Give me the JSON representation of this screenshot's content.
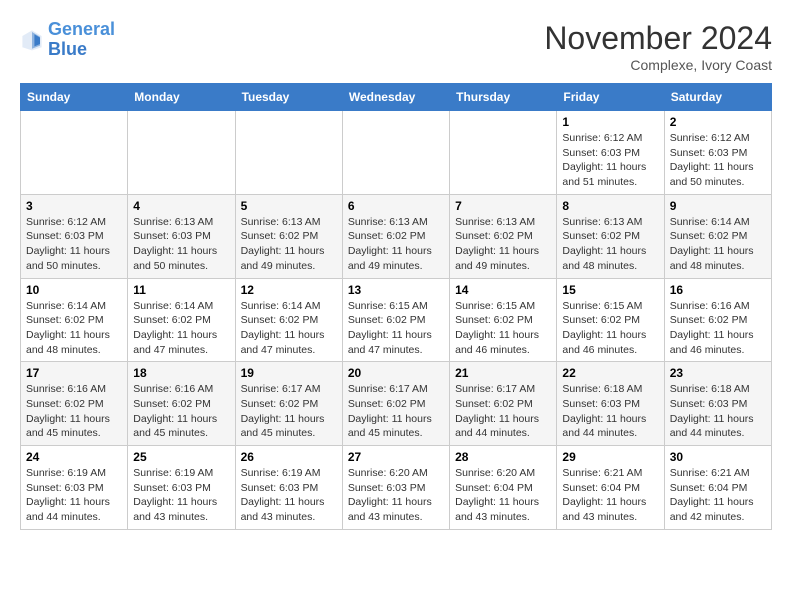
{
  "header": {
    "logo_line1": "General",
    "logo_line2": "Blue",
    "month": "November 2024",
    "location": "Complexe, Ivory Coast"
  },
  "weekdays": [
    "Sunday",
    "Monday",
    "Tuesday",
    "Wednesday",
    "Thursday",
    "Friday",
    "Saturday"
  ],
  "weeks": [
    [
      {
        "day": "",
        "info": ""
      },
      {
        "day": "",
        "info": ""
      },
      {
        "day": "",
        "info": ""
      },
      {
        "day": "",
        "info": ""
      },
      {
        "day": "",
        "info": ""
      },
      {
        "day": "1",
        "info": "Sunrise: 6:12 AM\nSunset: 6:03 PM\nDaylight: 11 hours\nand 51 minutes."
      },
      {
        "day": "2",
        "info": "Sunrise: 6:12 AM\nSunset: 6:03 PM\nDaylight: 11 hours\nand 50 minutes."
      }
    ],
    [
      {
        "day": "3",
        "info": "Sunrise: 6:12 AM\nSunset: 6:03 PM\nDaylight: 11 hours\nand 50 minutes."
      },
      {
        "day": "4",
        "info": "Sunrise: 6:13 AM\nSunset: 6:03 PM\nDaylight: 11 hours\nand 50 minutes."
      },
      {
        "day": "5",
        "info": "Sunrise: 6:13 AM\nSunset: 6:02 PM\nDaylight: 11 hours\nand 49 minutes."
      },
      {
        "day": "6",
        "info": "Sunrise: 6:13 AM\nSunset: 6:02 PM\nDaylight: 11 hours\nand 49 minutes."
      },
      {
        "day": "7",
        "info": "Sunrise: 6:13 AM\nSunset: 6:02 PM\nDaylight: 11 hours\nand 49 minutes."
      },
      {
        "day": "8",
        "info": "Sunrise: 6:13 AM\nSunset: 6:02 PM\nDaylight: 11 hours\nand 48 minutes."
      },
      {
        "day": "9",
        "info": "Sunrise: 6:14 AM\nSunset: 6:02 PM\nDaylight: 11 hours\nand 48 minutes."
      }
    ],
    [
      {
        "day": "10",
        "info": "Sunrise: 6:14 AM\nSunset: 6:02 PM\nDaylight: 11 hours\nand 48 minutes."
      },
      {
        "day": "11",
        "info": "Sunrise: 6:14 AM\nSunset: 6:02 PM\nDaylight: 11 hours\nand 47 minutes."
      },
      {
        "day": "12",
        "info": "Sunrise: 6:14 AM\nSunset: 6:02 PM\nDaylight: 11 hours\nand 47 minutes."
      },
      {
        "day": "13",
        "info": "Sunrise: 6:15 AM\nSunset: 6:02 PM\nDaylight: 11 hours\nand 47 minutes."
      },
      {
        "day": "14",
        "info": "Sunrise: 6:15 AM\nSunset: 6:02 PM\nDaylight: 11 hours\nand 46 minutes."
      },
      {
        "day": "15",
        "info": "Sunrise: 6:15 AM\nSunset: 6:02 PM\nDaylight: 11 hours\nand 46 minutes."
      },
      {
        "day": "16",
        "info": "Sunrise: 6:16 AM\nSunset: 6:02 PM\nDaylight: 11 hours\nand 46 minutes."
      }
    ],
    [
      {
        "day": "17",
        "info": "Sunrise: 6:16 AM\nSunset: 6:02 PM\nDaylight: 11 hours\nand 45 minutes."
      },
      {
        "day": "18",
        "info": "Sunrise: 6:16 AM\nSunset: 6:02 PM\nDaylight: 11 hours\nand 45 minutes."
      },
      {
        "day": "19",
        "info": "Sunrise: 6:17 AM\nSunset: 6:02 PM\nDaylight: 11 hours\nand 45 minutes."
      },
      {
        "day": "20",
        "info": "Sunrise: 6:17 AM\nSunset: 6:02 PM\nDaylight: 11 hours\nand 45 minutes."
      },
      {
        "day": "21",
        "info": "Sunrise: 6:17 AM\nSunset: 6:02 PM\nDaylight: 11 hours\nand 44 minutes."
      },
      {
        "day": "22",
        "info": "Sunrise: 6:18 AM\nSunset: 6:03 PM\nDaylight: 11 hours\nand 44 minutes."
      },
      {
        "day": "23",
        "info": "Sunrise: 6:18 AM\nSunset: 6:03 PM\nDaylight: 11 hours\nand 44 minutes."
      }
    ],
    [
      {
        "day": "24",
        "info": "Sunrise: 6:19 AM\nSunset: 6:03 PM\nDaylight: 11 hours\nand 44 minutes."
      },
      {
        "day": "25",
        "info": "Sunrise: 6:19 AM\nSunset: 6:03 PM\nDaylight: 11 hours\nand 43 minutes."
      },
      {
        "day": "26",
        "info": "Sunrise: 6:19 AM\nSunset: 6:03 PM\nDaylight: 11 hours\nand 43 minutes."
      },
      {
        "day": "27",
        "info": "Sunrise: 6:20 AM\nSunset: 6:03 PM\nDaylight: 11 hours\nand 43 minutes."
      },
      {
        "day": "28",
        "info": "Sunrise: 6:20 AM\nSunset: 6:04 PM\nDaylight: 11 hours\nand 43 minutes."
      },
      {
        "day": "29",
        "info": "Sunrise: 6:21 AM\nSunset: 6:04 PM\nDaylight: 11 hours\nand 43 minutes."
      },
      {
        "day": "30",
        "info": "Sunrise: 6:21 AM\nSunset: 6:04 PM\nDaylight: 11 hours\nand 42 minutes."
      }
    ]
  ]
}
